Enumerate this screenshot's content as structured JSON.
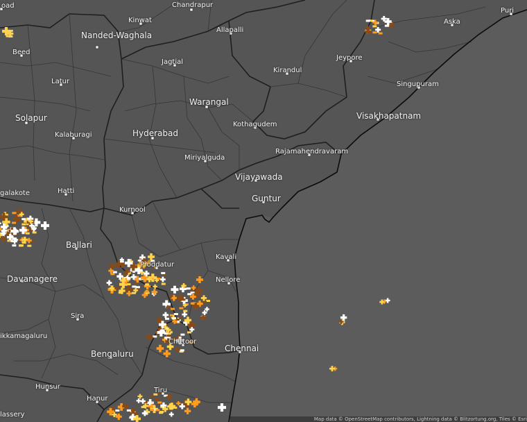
{
  "map": {
    "title": "",
    "colors": {
      "land": "#555555",
      "sea": "#5e5e5e",
      "border": "#222222",
      "coast": "#0e0e0e",
      "strike_recent": "#ffffff",
      "strike_mid": "#ffd34d",
      "strike_old": "#ff9a1a",
      "strike_oldest": "#8a4a16"
    },
    "cities": [
      {
        "name": "Chandrapur"
      },
      {
        "name": "Puri"
      },
      {
        "name": "Aska"
      },
      {
        "name": "Nanded-Waghala"
      },
      {
        "name": "Kinwat"
      },
      {
        "name": "Allapalli"
      },
      {
        "name": "Beed"
      },
      {
        "name": "Jeypore"
      },
      {
        "name": "Jagtial"
      },
      {
        "name": "Kirandul"
      },
      {
        "name": "Latur"
      },
      {
        "name": "Singupuram"
      },
      {
        "name": "Warangal"
      },
      {
        "name": "Visakhapatnam"
      },
      {
        "name": "Solapur"
      },
      {
        "name": "Kothagudem"
      },
      {
        "name": "Kalaburagi"
      },
      {
        "name": "Hyderabad"
      },
      {
        "name": "Rajamahendravaram"
      },
      {
        "name": "Miriyalguda"
      },
      {
        "name": "Vijayawada"
      },
      {
        "name": "Hatti"
      },
      {
        "name": "Guntur"
      },
      {
        "name": "Kurnool"
      },
      {
        "name": "Ballari"
      },
      {
        "name": "Kavali"
      },
      {
        "name": "Proddatur"
      },
      {
        "name": "Davanagere"
      },
      {
        "name": "Nellore"
      },
      {
        "name": "Sira"
      },
      {
        "name": "Chittoor"
      },
      {
        "name": "Chennai"
      },
      {
        "name": "Bengaluru"
      },
      {
        "name": "Hunsur"
      },
      {
        "name": "Hanur"
      },
      {
        "name": "Tiru"
      },
      {
        "name": "ikkamagaluru"
      },
      {
        "name": "galakote"
      },
      {
        "name": "oad"
      },
      {
        "name": "lassery"
      }
    ],
    "attribution": "Map data © OpenStreetMap contributors, Lightning data © Blitzortung.org, Tiles © Esri"
  }
}
